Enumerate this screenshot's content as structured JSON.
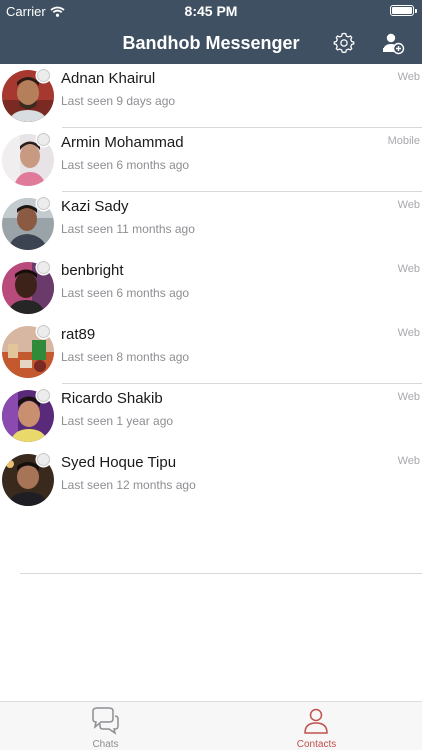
{
  "status_bar": {
    "carrier": "Carrier",
    "time": "8:45 PM"
  },
  "header": {
    "title": "Bandhob Messenger",
    "bg_color": "#3f5063"
  },
  "contacts": [
    {
      "name": "Adnan Khairul",
      "last_seen": "Last seen 9 days ago",
      "platform": "Web"
    },
    {
      "name": "Armin Mohammad",
      "last_seen": "Last seen 6 months ago",
      "platform": "Mobile"
    },
    {
      "name": "Kazi Sady",
      "last_seen": "Last seen 11 months ago",
      "platform": "Web"
    },
    {
      "name": "benbright",
      "last_seen": "Last seen 6 months ago",
      "platform": "Web"
    },
    {
      "name": "rat89",
      "last_seen": "Last seen 8 months ago",
      "platform": "Web"
    },
    {
      "name": "Ricardo Shakib",
      "last_seen": "Last seen 1 year ago",
      "platform": "Web"
    },
    {
      "name": "Syed Hoque Tipu",
      "last_seen": "Last seen 12 months ago",
      "platform": "Web"
    }
  ],
  "tabbar": {
    "chats_label": "Chats",
    "contacts_label": "Contacts",
    "active_color": "#c0504d",
    "inactive_color": "#8e8e93"
  }
}
